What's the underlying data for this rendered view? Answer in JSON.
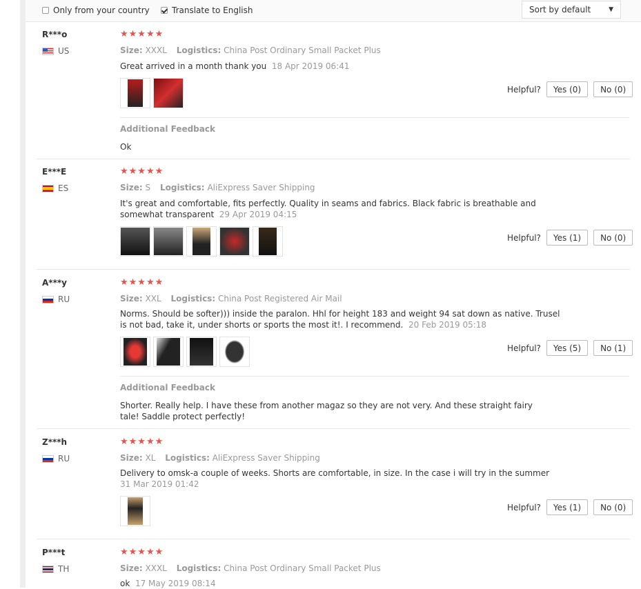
{
  "toolbar": {
    "only_country_label": "Only from your country",
    "translate_label": "Translate to English",
    "sort_value": "Sort by default",
    "only_country_checked": false,
    "translate_checked": true
  },
  "labels": {
    "size": "Size:",
    "logistics": "Logistics:",
    "helpful": "Helpful?",
    "additional_feedback": "Additional Feedback"
  },
  "reviews": [
    {
      "user": "R***o",
      "country": "US",
      "stars": "★★★★★",
      "size": "XXXL",
      "logistics": "China Post Ordinary Small Packet Plus",
      "text": "Great arrived in a month thank you",
      "date": "18 Apr 2019 06:41",
      "yes": "Yes (0)",
      "no": "No (0)",
      "additional": "Ok"
    },
    {
      "user": "E***E",
      "country": "ES",
      "stars": "★★★★★",
      "size": "S",
      "logistics": "AliExpress Saver Shipping",
      "text": "It's great and comfortable, fits perfectly. Quality in seams and fabrics. Black fabric is breathable and somewhat transparent",
      "date": "29 Apr 2019 04:15",
      "yes": "Yes (1)",
      "no": "No (0)"
    },
    {
      "user": "A***y",
      "country": "RU",
      "stars": "★★★★★",
      "size": "XXL",
      "logistics": "China Post Registered Air Mail",
      "text": "Norms. Should be softer))) inside the paralon. Hhl for height 183 and weight 94 sat down as native. Trusel is not bad, take it, under shorts or sports the most it!. I recommend.",
      "date": "20 Feb 2019 05:18",
      "yes": "Yes (5)",
      "no": "No (1)",
      "additional": "Shorter. Really help. I have these from another magaz so they are not very. And these straight fairy tale! Saddle protect perfectly!"
    },
    {
      "user": "Z***h",
      "country": "RU",
      "stars": "★★★★★",
      "size": "XL",
      "logistics": "AliExpress Saver Shipping",
      "text": "Delivery to omsk-a couple of weeks. Shorts are comfortable, in size. In the case i will try in the summer",
      "date": "31 Mar 2019 01:42",
      "yes": "Yes (1)",
      "no": "No (0)"
    },
    {
      "user": "P***t",
      "country": "TH",
      "stars": "★★★★★",
      "size": "XXXL",
      "logistics": "China Post Ordinary Small Packet Plus",
      "text": "ok",
      "date": "17 May 2019 08:14"
    }
  ]
}
